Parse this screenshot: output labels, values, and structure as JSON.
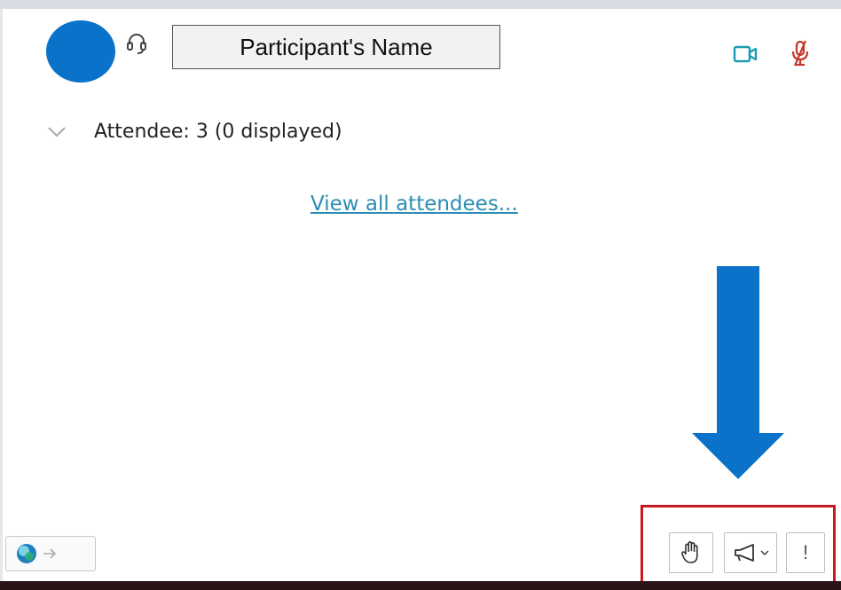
{
  "participant": {
    "name_label": "Participant's Name",
    "avatar_color": "#0a72c8",
    "icons": [
      "headset-icon",
      "video-camera-icon",
      "microphone-off-icon"
    ]
  },
  "attendees": {
    "label": "Attendee: 3 (0 displayed)",
    "view_all_link": "View all attendees..."
  },
  "toolbar": {
    "items": [
      "raise-hand-icon",
      "megaphone-icon",
      "chevron-down-icon",
      "more-options-icon"
    ],
    "more_label": "!"
  },
  "annotation": {
    "arrow_color": "#0a72c8",
    "highlight_color": "#c8191f"
  },
  "status": {
    "icons": [
      "status-orb-icon",
      "arrow-right-icon"
    ]
  },
  "colors": {
    "link": "#2b8eb3",
    "video_icon": "#1a9bb0",
    "mic_off_icon": "#c0392b"
  }
}
